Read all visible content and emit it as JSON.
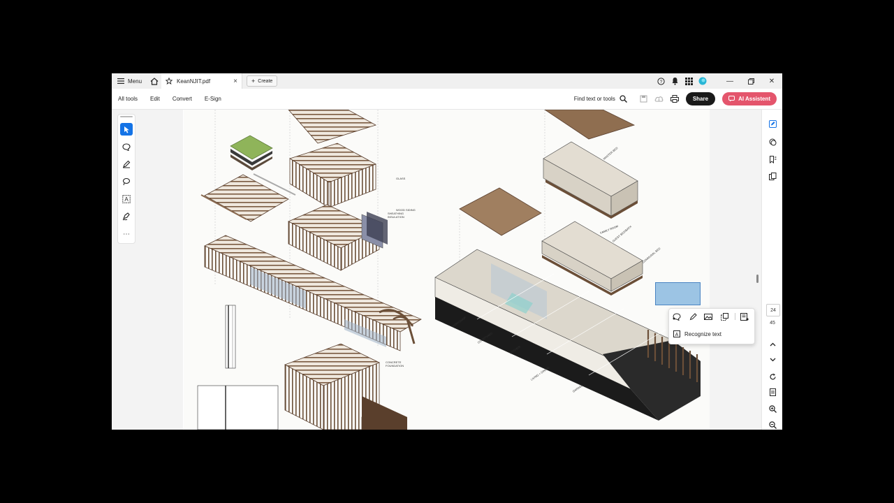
{
  "titlebar": {
    "menu_label": "Menu",
    "tab_title": "KeanNJIT.pdf",
    "create_label": "Create",
    "help_icon": "help-icon",
    "bell_icon": "bell-icon",
    "apps_icon": "apps-grid-icon"
  },
  "toolbar": {
    "items": [
      "All tools",
      "Edit",
      "Convert",
      "E-Sign"
    ],
    "find_label": "Find text or tools",
    "share_label": "Share",
    "ai_label": "AI Assistent"
  },
  "page_nav": {
    "current": "24",
    "total": "45"
  },
  "popup": {
    "recognize_label": "Recognize text"
  },
  "drawing_labels": {
    "glass": "GLASS",
    "wood_siding": "WOOD SIDING",
    "sheathing": "SHEATHING",
    "insulation": "INSULATION",
    "concrete": "CONCRETE",
    "foundation": "FOUNDATION",
    "master_bed": "MASTER BED",
    "family_room": "FAMILY ROOM",
    "guest_bed": "GUEST BED/BATH",
    "communal_bed": "COMMUNAL BED",
    "workshop": "WORKSHOP",
    "courtyard": "COURTYARD",
    "kitchen": "KITCHEN",
    "living_dining": "LIVING + DINING",
    "garage": "GARAGE"
  },
  "colors": {
    "accent": "#1473e6",
    "ai": "#e4556c",
    "selection": "#9cc4e4"
  }
}
